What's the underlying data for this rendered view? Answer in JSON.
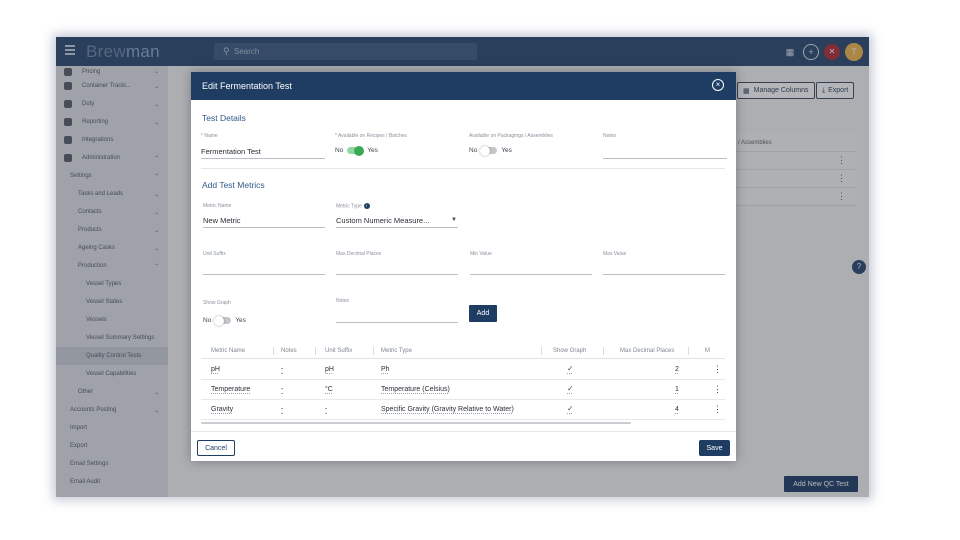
{
  "app": {
    "brand_part1": "Brew",
    "brand_part2": "man",
    "search_placeholder": "Search",
    "user_initial": "T"
  },
  "sidebar": {
    "items": [
      {
        "label": "Pricing"
      },
      {
        "label": "Container Tracki..."
      },
      {
        "label": "Duty"
      },
      {
        "label": "Reporting"
      },
      {
        "label": "Integrations"
      },
      {
        "label": "Administration"
      },
      {
        "label": "Settings"
      },
      {
        "label": "Tasks and Leads"
      },
      {
        "label": "Contacts"
      },
      {
        "label": "Products"
      },
      {
        "label": "Ageing Casks"
      },
      {
        "label": "Production"
      },
      {
        "label": "Vessel Types"
      },
      {
        "label": "Vessel States"
      },
      {
        "label": "Vessels"
      },
      {
        "label": "Vessel Summary Settings"
      },
      {
        "label": "Quality Control Tests"
      },
      {
        "label": "Vessel Capabilities"
      },
      {
        "label": "Other"
      },
      {
        "label": "Accounts Posting"
      },
      {
        "label": "Import"
      },
      {
        "label": "Export"
      },
      {
        "label": "Email Settings"
      },
      {
        "label": "Email Audit"
      }
    ]
  },
  "background": {
    "manage_columns": "Manage Columns",
    "export": "Export",
    "assemblies_header": "/ Assemblies",
    "add_new_qc_test": "Add New QC Test"
  },
  "modal": {
    "title": "Edit Fermentation Test",
    "test_details": {
      "section_title": "Test Details",
      "name_label": "* Name",
      "name_value": "Fermentation Test",
      "recipes_label": "* Available on Recipes / Batches",
      "recipes_no": "No",
      "recipes_yes": "Yes",
      "recipes_on": true,
      "packagings_label": "Available on Packagings / Assemblies",
      "packagings_no": "No",
      "packagings_yes": "Yes",
      "packagings_on": false,
      "notes_label": "Notes",
      "notes_value": ""
    },
    "add_metrics": {
      "section_title": "Add Test Metrics",
      "metric_name_label": "Metric Name",
      "metric_name_value": "New Metric",
      "metric_type_label": "Metric Type",
      "metric_type_value": "Custom Numeric Measure...",
      "unit_suffix_label": "Unit Suffix",
      "max_decimal_label": "Max Decimal Places",
      "min_value_label": "Min Value",
      "max_value_label": "Max Value",
      "show_graph_label": "Show Graph",
      "show_graph_no": "No",
      "show_graph_yes": "Yes",
      "notes_label": "Notes",
      "add_button": "Add"
    },
    "table": {
      "headers": {
        "metric_name": "Metric Name",
        "notes": "Notes",
        "unit_suffix": "Unit Suffix",
        "metric_type": "Metric Type",
        "show_graph": "Show Graph",
        "max_decimal": "Max Decimal Places",
        "m": "M"
      },
      "rows": [
        {
          "metric_name": "pH",
          "notes": "-",
          "unit_suffix": "pH",
          "metric_type": "Ph",
          "max_decimal": "2"
        },
        {
          "metric_name": "Temperature",
          "notes": "-",
          "unit_suffix": "°C",
          "metric_type": "Temperature (Celsius)",
          "max_decimal": "1"
        },
        {
          "metric_name": "Gravity",
          "notes": "-",
          "unit_suffix": "-",
          "metric_type": "Specific Gravity (Gravity Relative to Water)",
          "max_decimal": "4"
        }
      ]
    },
    "cancel": "Cancel",
    "save": "Save"
  },
  "icons": {
    "check": "✓",
    "kebab": "⋮",
    "close": "×",
    "help": "?"
  }
}
